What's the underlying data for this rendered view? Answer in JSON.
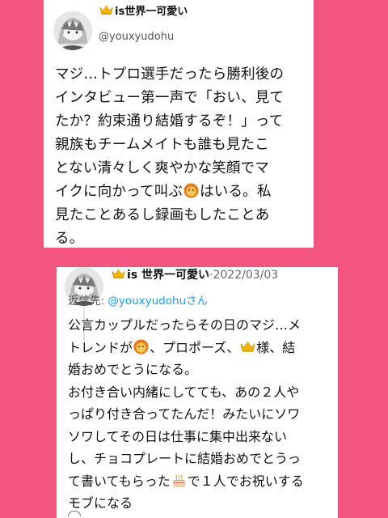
{
  "tweet1": {
    "display_name": "is世界一可愛い",
    "handle": "@youxyudohu",
    "body_lines": [
      "マジ…トプロ選手だったら勝利後の",
      "インタビュー第一声で「おい、見て",
      "たか？約束通り結婚するぞ！」って",
      "親族もチームメイトも誰も見たこ",
      "とない清々しく爽やかな笑顔でマ"
    ],
    "line6_before": "イクに向かって叫ぶ",
    "line6_after": "はいる。私",
    "line7": "見たことあるし録画もしたことあ",
    "line8": "る。"
  },
  "tweet2": {
    "display_name": "is 世界一可愛い",
    "separator": "·",
    "date": "2022/03/03",
    "reply_prefix": "返信先: ",
    "reply_mention": "@youxyudohu",
    "reply_suffix": "さん",
    "line1": "公言カップルだったらその日のマジ…メ",
    "line2_a": "トレンドが",
    "line2_b": "、プロポーズ、",
    "line2_c": "様、結",
    "line3": "婚おめでとうになる。",
    "line4": "お付き合い内緒にしてても、あの２人や",
    "line5": "っぱり付き合ってたんだ！みたいにソワ",
    "line6": "ソワしてその日は仕事に集中出来ない",
    "line7": "し、チョコプレートに結婚おめでとうっ",
    "line8_a": "て書いてもらった",
    "line8_b": "で１人でお祝いする",
    "line9": "モブになる"
  },
  "icons": {
    "crown": "crown-icon",
    "lion": "lion-face-icon",
    "cake": "birthday-cake-icon",
    "reply": "reply-icon"
  },
  "colors": {
    "background": "#f2557f",
    "card": "#ffffff",
    "mention": "#1d9bf0"
  }
}
